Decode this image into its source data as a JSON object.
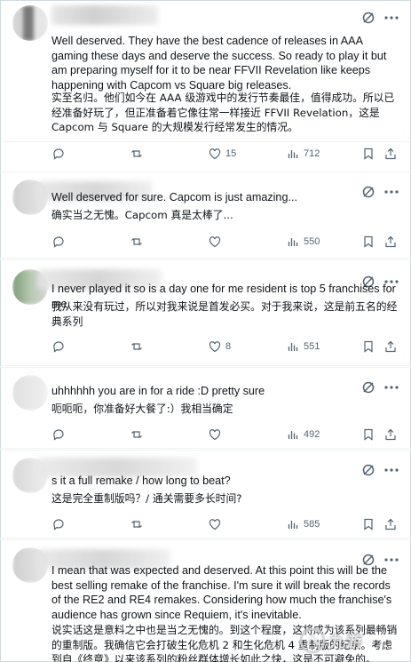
{
  "replies": [
    {
      "id": "r1",
      "text_en": "Well deserved. They have the best cadence of releases in AAA gaming these days and deserve the success. So ready to play it but am preparing myself for it to be near FFVII Revelation like keeps happening with Capcom vs Square big releases.",
      "text_zh": "实至名归。他们如今在 AAA 级游戏中的发行节奏最佳，值得成功。所以已经准备好玩了，但正准备着它像往常一样接近 FFVII Revelation，这是 Capcom 与 Square 的大规模发行经常发生的情况。",
      "replies": "",
      "reposts": "",
      "likes": "15",
      "views": "712"
    },
    {
      "id": "r2",
      "text_en": "Well deserved for sure. Capcom is just amazing...",
      "text_zh": "确实当之无愧。Capcom 真是太棒了...",
      "replies": "",
      "reposts": "",
      "likes": "",
      "views": "550"
    },
    {
      "id": "r3",
      "text_en": "I never played it so is a day one for me resident is top 5 franchises for me",
      "text_zh": "我从来没有玩过，所以对我来说是首发必买。对于我来说，这是前五名的经典系列",
      "replies": "",
      "reposts": "",
      "likes": "8",
      "views": "551"
    },
    {
      "id": "r4",
      "text_en": "uhhhhhh you are in for a ride :D pretty sure",
      "text_zh": "呃呃呃，你准备好大餐了:）我相当确定",
      "replies": "",
      "reposts": "",
      "likes": "",
      "views": "492"
    },
    {
      "id": "r5",
      "text_en": "s it a full remake / how long to beat?",
      "text_zh": "这是完全重制版吗？/ 通关需要多长时间?",
      "replies": "",
      "reposts": "",
      "likes": "",
      "views": "585"
    },
    {
      "id": "r6",
      "text_en": "I mean that was expected and deserved. At this point this will be the best selling remake of the franchise. I'm sure it will break the records of the RE2 and RE4 remakes. Considering how much the franchise's audience has grown since Requiem, it's inevitable.",
      "text_zh": "说实话这是意料之中也是当之无愧的。到这个程度，这将成为该系列最畅销的重制版。我确信它会打破生化危机 2 和生化危机 4 重制版的纪录。考虑到自《终章》以来该系列的粉丝群体增长如此之快，这是不可避免的。",
      "replies": "",
      "reposts": "",
      "likes": "",
      "views": ""
    }
  ],
  "watermark": {
    "text": "九游",
    "logo": "jiuyou-logo-icon"
  },
  "colors": {
    "icon": "#536471",
    "border": "#eff3f4",
    "text": "#0f1419"
  }
}
